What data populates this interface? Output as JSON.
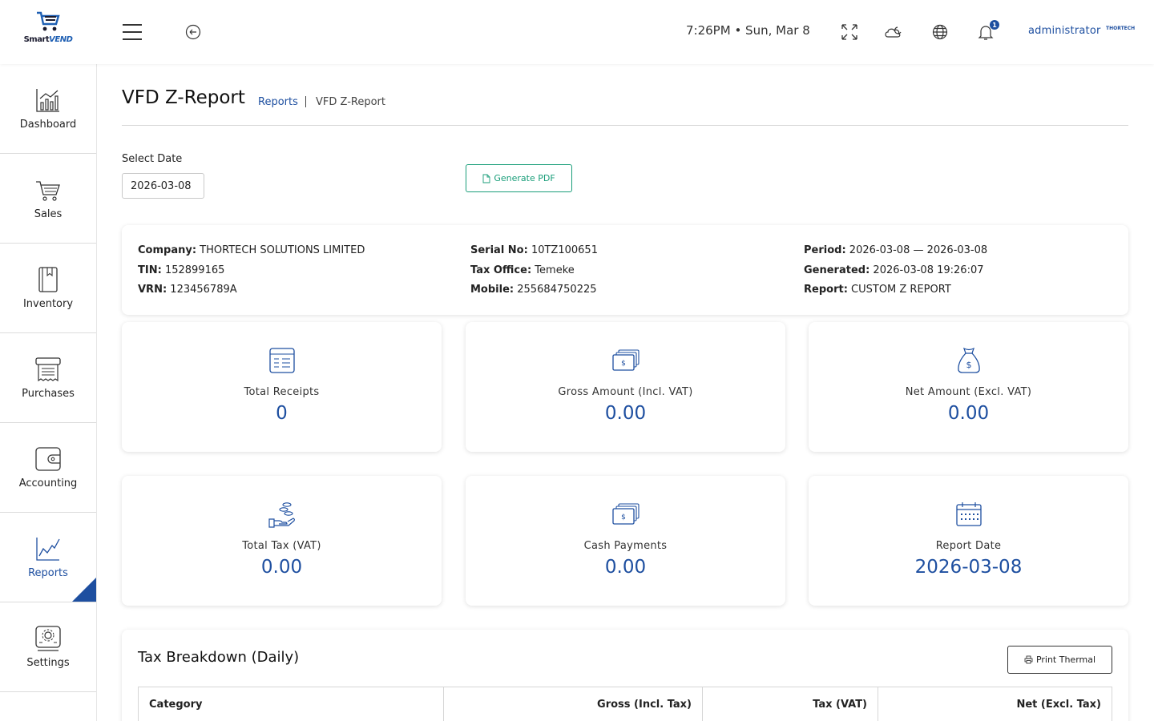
{
  "header": {
    "logo_brand_a": "Smart",
    "logo_brand_b": "VEND",
    "clock": "7:26PM • Sun, Mar 8",
    "notification_count": "1",
    "user": "administrator",
    "user_logo": "THORTECH"
  },
  "sidebar": {
    "items": [
      {
        "label": "Dashboard",
        "icon": "dashboard-chart-icon"
      },
      {
        "label": "Sales",
        "icon": "cart-icon"
      },
      {
        "label": "Inventory",
        "icon": "book-icon"
      },
      {
        "label": "Purchases",
        "icon": "receipt-icon"
      },
      {
        "label": "Accounting",
        "icon": "wallet-icon"
      },
      {
        "label": "Reports",
        "icon": "line-chart-icon",
        "active": true
      },
      {
        "label": "Settings",
        "icon": "settings-gear-icon"
      }
    ]
  },
  "page": {
    "title": "VFD Z-Report",
    "breadcrumb_link": "Reports",
    "breadcrumb_current": "VFD Z-Report"
  },
  "filter": {
    "date_label": "Select Date",
    "date_value": "2026-03-08",
    "generate_pdf": "Generate PDF"
  },
  "info": {
    "company_label": "Company:",
    "company": "THORTECH SOLUTIONS LIMITED",
    "tin_label": "TIN:",
    "tin": "152899165",
    "vrn_label": "VRN:",
    "vrn": "123456789A",
    "serial_label": "Serial No:",
    "serial": "10TZ100651",
    "tax_office_label": "Tax Office:",
    "tax_office": "Temeke",
    "mobile_label": "Mobile:",
    "mobile": "255684750225",
    "period_label": "Period:",
    "period": "2026-03-08 — 2026-03-08",
    "generated_label": "Generated:",
    "generated": "2026-03-08 19:26:07",
    "report_label": "Report:",
    "report": "CUSTOM Z REPORT"
  },
  "stats": [
    {
      "label": "Total Receipts",
      "value": "0",
      "icon": "receipt-list-icon"
    },
    {
      "label": "Gross Amount (Incl. VAT)",
      "value": "0.00",
      "icon": "banknotes-icon"
    },
    {
      "label": "Net Amount (Excl. VAT)",
      "value": "0.00",
      "icon": "money-bag-icon"
    },
    {
      "label": "Total Tax (VAT)",
      "value": "0.00",
      "icon": "hand-coins-icon"
    },
    {
      "label": "Cash Payments",
      "value": "0.00",
      "icon": "banknotes-icon"
    },
    {
      "label": "Report Date",
      "value": "2026-03-08",
      "icon": "calendar-icon"
    }
  ],
  "tax": {
    "title": "Tax Breakdown (Daily)",
    "print_thermal": "Print Thermal",
    "columns": [
      "Category",
      "Gross (Incl. Tax)",
      "Tax (VAT)",
      "Net (Excl. Tax)"
    ]
  },
  "colors": {
    "accent": "#1e4fa0",
    "success": "#1a9e7a"
  }
}
